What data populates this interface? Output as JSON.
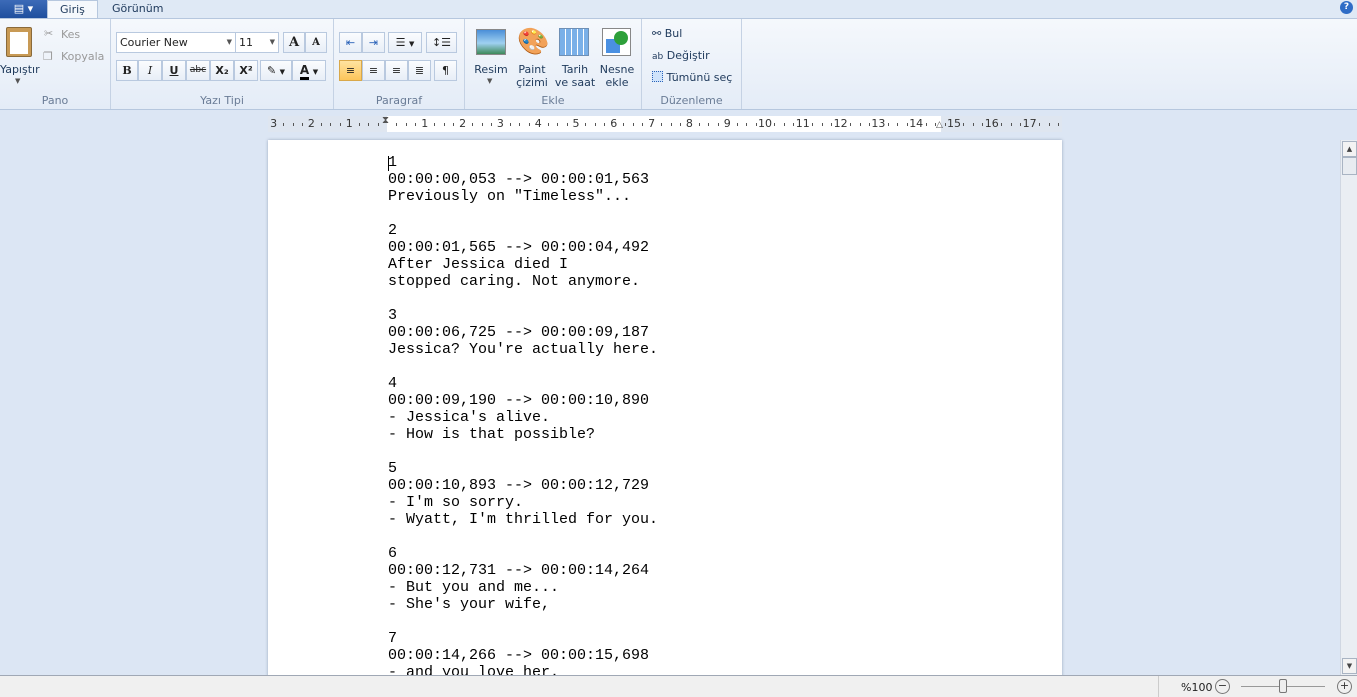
{
  "tabs": {
    "app_menu": "▤ ▾",
    "home": "Giriş",
    "view": "Görünüm",
    "help": "?"
  },
  "clipboard": {
    "paste": "Yapıştır",
    "cut": "Kes",
    "copy": "Kopyala",
    "group": "Pano"
  },
  "font": {
    "name": "Courier New",
    "size": "11",
    "grow": "A",
    "shrink": "A",
    "bold": "B",
    "italic": "I",
    "underline": "U",
    "strike": "abc",
    "sub": "X₂",
    "sup": "X²",
    "group": "Yazı Tipi"
  },
  "paragraph": {
    "group": "Paragraf"
  },
  "insert": {
    "picture": "Resim",
    "paint_line1": "Paint",
    "paint_line2": "çizimi",
    "date_line1": "Tarih",
    "date_line2": "ve saat",
    "object_line1": "Nesne",
    "object_line2": "ekle",
    "group": "Ekle"
  },
  "editing": {
    "find": "Bul",
    "replace": "Değiştir",
    "select_all": "Tümünü seç",
    "group": "Düzenleme"
  },
  "ruler": {
    "left_labels": [
      "3",
      "2",
      "1"
    ],
    "right_labels": [
      "1",
      "2",
      "3",
      "4",
      "5",
      "6",
      "7",
      "8",
      "9",
      "10",
      "11",
      "12",
      "13",
      "14",
      "15",
      "16",
      "17"
    ]
  },
  "document": {
    "lines": [
      "1",
      "00:00:00,053 --> 00:00:01,563",
      "Previously on \"Timeless\"...",
      "",
      "2",
      "00:00:01,565 --> 00:00:04,492",
      "After Jessica died I",
      "stopped caring. Not anymore.",
      "",
      "3",
      "00:00:06,725 --> 00:00:09,187",
      "Jessica? You're actually here.",
      "",
      "4",
      "00:00:09,190 --> 00:00:10,890",
      "- Jessica's alive.",
      "- How is that possible?",
      "",
      "5",
      "00:00:10,893 --> 00:00:12,729",
      "- I'm so sorry.",
      "- Wyatt, I'm thrilled for you.",
      "",
      "6",
      "00:00:12,731 --> 00:00:14,264",
      "- But you and me...",
      "- She's your wife,",
      "",
      "7",
      "00:00:14,266 --> 00:00:15,698",
      "- and you love her."
    ]
  },
  "status": {
    "zoom": "%100",
    "zoom_percent": 100
  }
}
